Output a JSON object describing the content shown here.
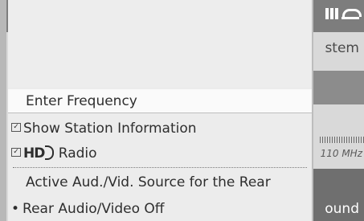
{
  "background": {
    "partial_label_top": "stem",
    "partial_label_bottom": "ound",
    "frequency_unit": "110 MHz"
  },
  "menu": {
    "items": [
      {
        "label": "Enter Frequency",
        "kind": "action"
      },
      {
        "label": "Show Station Information",
        "kind": "checkbox",
        "checked": true
      },
      {
        "label": "Radio",
        "prefix_logo": "HD",
        "kind": "checkbox",
        "checked": true
      },
      {
        "label": "Active Aud./Vid. Source for the Rear",
        "kind": "header"
      },
      {
        "label": "Rear Audio/Video Off",
        "kind": "radio",
        "selected": true
      }
    ],
    "check_glyph": "✓",
    "bullet_glyph": "•",
    "hd_logo_text": "HD"
  },
  "colors": {
    "menu_bg": "#ececec",
    "highlight_bg": "#fafafa",
    "text": "#2e2e2e"
  }
}
